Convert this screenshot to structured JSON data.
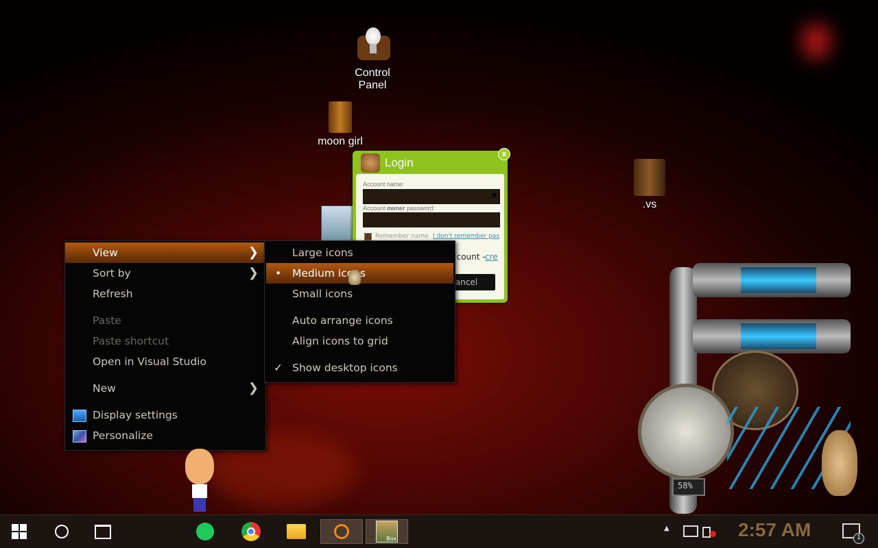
{
  "desktop": {
    "icons": [
      {
        "label": "Control\nPanel",
        "label1": "Control",
        "label2": "Panel",
        "icon": "lightbulb-icon"
      },
      {
        "label": "moon girl",
        "icon": "trash-bin-icon"
      },
      {
        "label": ".vs",
        "icon": "folder-icon"
      }
    ]
  },
  "context_menu": {
    "items": [
      {
        "label": "View",
        "has_submenu": true,
        "highlighted": true
      },
      {
        "label": "Sort by",
        "has_submenu": true
      },
      {
        "label": "Refresh"
      },
      {
        "label": "Paste",
        "disabled": true
      },
      {
        "label": "Paste shortcut",
        "disabled": true
      },
      {
        "label": "Open in Visual Studio"
      },
      {
        "label": "New",
        "has_submenu": true
      },
      {
        "label": "Display settings",
        "icon": "display-icon"
      },
      {
        "label": "Personalize",
        "icon": "personalize-icon"
      }
    ]
  },
  "view_submenu": {
    "items": [
      {
        "label": "Large icons"
      },
      {
        "label": "Medium icons",
        "selected": true,
        "mark": "•"
      },
      {
        "label": "Small icons"
      },
      {
        "label": "Auto arrange icons"
      },
      {
        "label": "Align icons to grid"
      },
      {
        "label": "Show desktop icons",
        "checked": true,
        "mark": "✓"
      }
    ]
  },
  "login_widget": {
    "title": "Login",
    "account_name_label": "Account name:",
    "password_label_pre": "Account ",
    "password_label_bold": "owner",
    "password_label_post": " password:",
    "remember_label": "Remember name",
    "forgot_link": "I don't remember pas",
    "account_text": "ccount - ",
    "create_link": "cre",
    "cancel_label": "ancel"
  },
  "gauge": {
    "percent_text": "58%"
  },
  "taskbar": {
    "clock": "2:57 AM",
    "notification_count": "1",
    "apps": [
      {
        "name": "start",
        "icon": "windows-start-icon"
      },
      {
        "name": "search",
        "icon": "cortana-circle-icon"
      },
      {
        "name": "task-view",
        "icon": "task-view-icon"
      },
      {
        "name": "spotify",
        "icon": "spotify-icon"
      },
      {
        "name": "chrome",
        "icon": "chrome-icon"
      },
      {
        "name": "file-explorer",
        "icon": "folder-icon"
      },
      {
        "name": "search-app",
        "icon": "magnifier-icon"
      },
      {
        "name": "box",
        "icon": "box-app-icon",
        "label": "Box"
      }
    ]
  },
  "colors": {
    "menu_highlight": "#b25a12",
    "widget_green": "#8ec21c",
    "clock": "#8a6a3a"
  }
}
